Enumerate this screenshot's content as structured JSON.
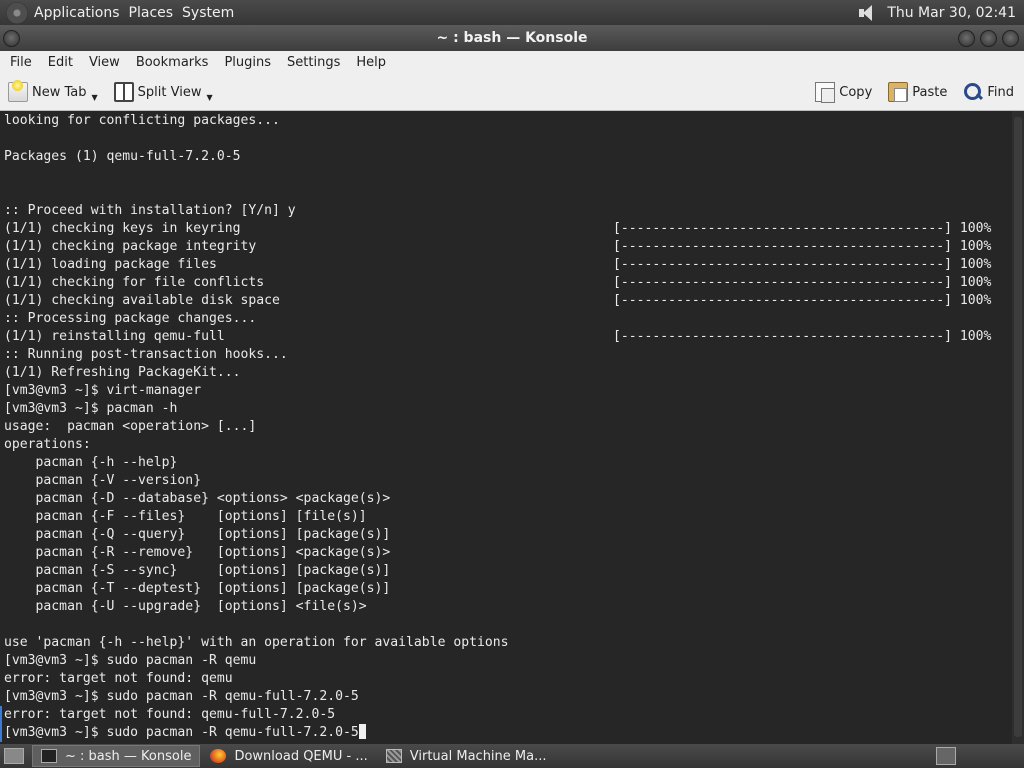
{
  "top_panel": {
    "menus": [
      "Applications",
      "Places",
      "System"
    ],
    "clock": "Thu Mar 30, 02:41"
  },
  "window": {
    "title": "~ : bash — Konsole"
  },
  "menubar": {
    "items": [
      "File",
      "Edit",
      "View",
      "Bookmarks",
      "Plugins",
      "Settings",
      "Help"
    ]
  },
  "toolbar": {
    "new_tab": "New Tab",
    "split_view": "Split View",
    "copy": "Copy",
    "paste": "Paste",
    "find": "Find"
  },
  "terminal": {
    "lines": [
      {
        "text": "looking for conflicting packages..."
      },
      {
        "text": ""
      },
      {
        "text": "Packages (1) qemu-full-7.2.0-5"
      },
      {
        "text": ""
      },
      {
        "text": ""
      },
      {
        "text": ":: Proceed with installation? [Y/n] y"
      },
      {
        "text": "(1/1) checking keys in keyring",
        "right": "[-----------------------------------------] 100%"
      },
      {
        "text": "(1/1) checking package integrity",
        "right": "[-----------------------------------------] 100%"
      },
      {
        "text": "(1/1) loading package files",
        "right": "[-----------------------------------------] 100%"
      },
      {
        "text": "(1/1) checking for file conflicts",
        "right": "[-----------------------------------------] 100%"
      },
      {
        "text": "(1/1) checking available disk space",
        "right": "[-----------------------------------------] 100%"
      },
      {
        "text": ":: Processing package changes..."
      },
      {
        "text": "(1/1) reinstalling qemu-full",
        "right": "[-----------------------------------------] 100%"
      },
      {
        "text": ":: Running post-transaction hooks..."
      },
      {
        "text": "(1/1) Refreshing PackageKit..."
      },
      {
        "text": "[vm3@vm3 ~]$ virt-manager"
      },
      {
        "text": "[vm3@vm3 ~]$ pacman -h"
      },
      {
        "text": "usage:  pacman <operation> [...]"
      },
      {
        "text": "operations:"
      },
      {
        "text": "    pacman {-h --help}"
      },
      {
        "text": "    pacman {-V --version}"
      },
      {
        "text": "    pacman {-D --database} <options> <package(s)>"
      },
      {
        "text": "    pacman {-F --files}    [options] [file(s)]"
      },
      {
        "text": "    pacman {-Q --query}    [options] [package(s)]"
      },
      {
        "text": "    pacman {-R --remove}   [options] <package(s)>"
      },
      {
        "text": "    pacman {-S --sync}     [options] [package(s)]"
      },
      {
        "text": "    pacman {-T --deptest}  [options] [package(s)]"
      },
      {
        "text": "    pacman {-U --upgrade}  [options] <file(s)>"
      },
      {
        "text": ""
      },
      {
        "text": "use 'pacman {-h --help}' with an operation for available options"
      },
      {
        "text": "[vm3@vm3 ~]$ sudo pacman -R qemu"
      },
      {
        "text": "error: target not found: qemu"
      },
      {
        "text": "[vm3@vm3 ~]$ sudo pacman -R qemu-full-7.2.0-5"
      },
      {
        "text": "error: target not found: qemu-full-7.2.0-5",
        "marked": true
      },
      {
        "text": "[vm3@vm3 ~]$ sudo pacman -R qemu-full-7.2.0-5",
        "cursor": true,
        "marked": true
      }
    ]
  },
  "taskbar": {
    "tasks": [
      {
        "label": "~ : bash — Konsole",
        "icon": "konsole-icon",
        "active": true
      },
      {
        "label": "Download QEMU - ...",
        "icon": "firefox-icon",
        "active": false
      },
      {
        "label": "Virtual Machine Ma...",
        "icon": "virt-manager-icon",
        "active": false
      }
    ]
  }
}
